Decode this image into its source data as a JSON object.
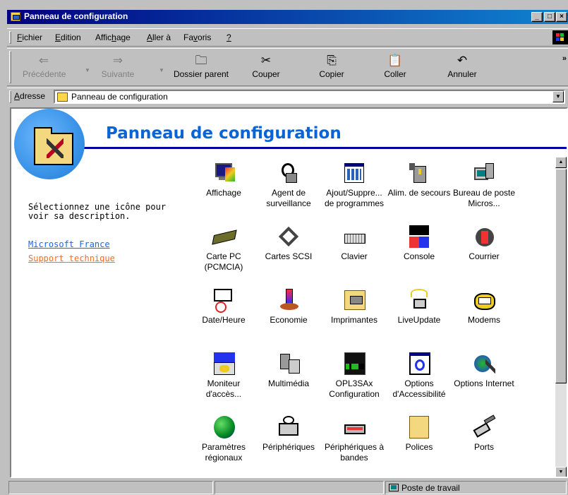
{
  "window": {
    "title": "Panneau de configuration"
  },
  "title_buttons": {
    "minimize": "_",
    "maximize": "□",
    "close": "×"
  },
  "menu": [
    "Fichier",
    "Edition",
    "Affichage",
    "Aller à",
    "Favoris",
    "?"
  ],
  "menu_mnemonics": [
    "F",
    "E",
    "h",
    "A",
    "v",
    "?"
  ],
  "toolbar": {
    "back": "Précédente",
    "forward": "Suivante",
    "up": "Dossier parent",
    "cut": "Couper",
    "copy": "Copier",
    "paste": "Coller",
    "undo": "Annuler",
    "more": "»"
  },
  "address": {
    "label": "Adresse",
    "value": "Panneau de configuration"
  },
  "main": {
    "title": "Panneau de configuration",
    "description": "Sélectionnez une icône pour voir sa description.",
    "links": [
      "Microsoft France",
      "Support technique"
    ]
  },
  "items": [
    {
      "id": "affichage",
      "label": "Affichage",
      "icon": "display-icon"
    },
    {
      "id": "agent",
      "label": "Agent de surveillance",
      "icon": "monitoring-agent-icon"
    },
    {
      "id": "ajout",
      "label": "Ajout/Suppre... de programmes",
      "icon": "add-remove-programs-icon"
    },
    {
      "id": "alim",
      "label": "Alim. de secours",
      "icon": "ups-icon"
    },
    {
      "id": "bureau",
      "label": "Bureau de poste Micros...",
      "icon": "postoffice-icon"
    },
    {
      "id": "cartepc",
      "label": "Carte PC (PCMCIA)",
      "icon": "pccard-icon"
    },
    {
      "id": "scsi",
      "label": "Cartes SCSI",
      "icon": "scsi-icon"
    },
    {
      "id": "clavier",
      "label": "Clavier",
      "icon": "keyboard-icon"
    },
    {
      "id": "console",
      "label": "Console",
      "icon": "console-icon"
    },
    {
      "id": "courrier",
      "label": "Courrier",
      "icon": "mail-icon"
    },
    {
      "id": "date",
      "label": "Date/Heure",
      "icon": "date-time-icon"
    },
    {
      "id": "eco",
      "label": "Economie",
      "icon": "power-icon"
    },
    {
      "id": "impr",
      "label": "Imprimantes",
      "icon": "printers-icon"
    },
    {
      "id": "live",
      "label": "LiveUpdate",
      "icon": "liveupdate-icon"
    },
    {
      "id": "modems",
      "label": "Modems",
      "icon": "modem-icon"
    },
    {
      "id": "moniteur",
      "label": "Moniteur d'accès...",
      "icon": "access-monitor-icon"
    },
    {
      "id": "multi",
      "label": "Multimédia",
      "icon": "multimedia-icon"
    },
    {
      "id": "opl",
      "label": "OPL3SAx Configuration",
      "icon": "opl3sax-icon"
    },
    {
      "id": "options",
      "label": "Options d'Accessibilité",
      "icon": "accessibility-icon"
    },
    {
      "id": "inet",
      "label": "Options Internet",
      "icon": "internet-options-icon"
    },
    {
      "id": "param",
      "label": "Paramètres régionaux",
      "icon": "regional-settings-icon"
    },
    {
      "id": "periph",
      "label": "Périphériques",
      "icon": "devices-icon"
    },
    {
      "id": "bandes",
      "label": "Périphériques à bandes",
      "icon": "tape-devices-icon"
    },
    {
      "id": "polices",
      "label": "Polices",
      "icon": "fonts-icon"
    },
    {
      "id": "ports",
      "label": "Ports",
      "icon": "ports-icon"
    }
  ],
  "status": {
    "zone": "Poste de travail"
  },
  "colors": {
    "title_gradient_start": "#000080",
    "title_gradient_end": "#1084d0",
    "heading": "#0a64d6",
    "link": "#1f66e0",
    "link_visited": "#ff6a22"
  }
}
